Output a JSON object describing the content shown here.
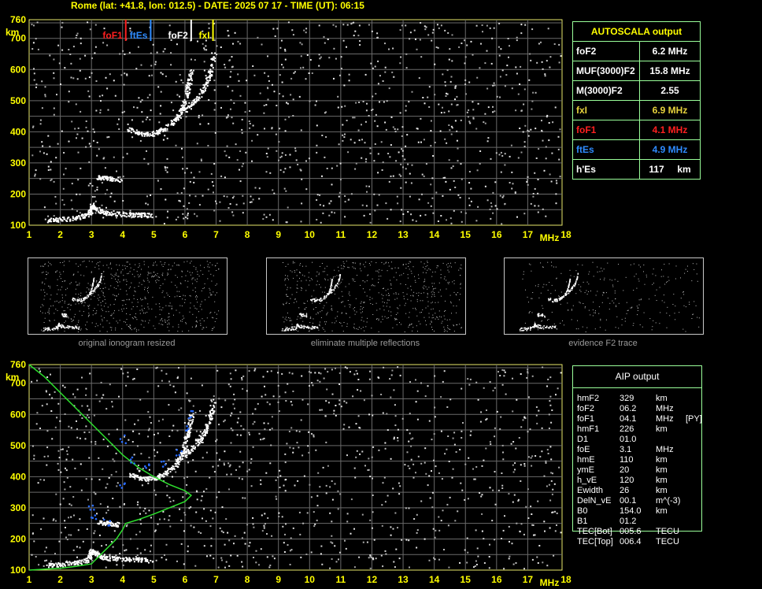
{
  "header": "Rome (lat: +41.8, lon: 012.5) - DATE: 2025 07 17 - TIME (UT): 06:15",
  "axes": {
    "x_ticks": [
      "1",
      "2",
      "3",
      "4",
      "5",
      "6",
      "7",
      "8",
      "9",
      "10",
      "11",
      "12",
      "13",
      "14",
      "15",
      "16",
      "17",
      "18"
    ],
    "x_unit": "MHz",
    "y_ticks": [
      "100",
      "200",
      "300",
      "400",
      "500",
      "600",
      "700",
      "760"
    ],
    "y_unit": "km"
  },
  "top_markers": [
    {
      "label": "foF1",
      "freq": 4.1,
      "color": "#ff2020"
    },
    {
      "label": "ftEs",
      "freq": 4.9,
      "color": "#2f8cff"
    },
    {
      "label": "foF2",
      "freq": 6.2,
      "color": "#ffffff"
    },
    {
      "label": "fxI",
      "freq": 6.9,
      "color": "#ffff00"
    }
  ],
  "autoscala": {
    "title": "AUTOSCALA output",
    "rows": [
      {
        "name": "foF2",
        "value": "6.2 MHz",
        "color": "#ffffff"
      },
      {
        "name": "MUF(3000)F2",
        "value": "15.8 MHz",
        "color": "#ffffff"
      },
      {
        "name": "M(3000)F2",
        "value": "2.55",
        "color": "#ffffff"
      },
      {
        "name": "fxI",
        "value": "6.9 MHz",
        "color": "#e6d23c"
      },
      {
        "name": "foF1",
        "value": "4.1 MHz",
        "color": "#ff2020"
      },
      {
        "name": "ftEs",
        "value": "4.9 MHz",
        "color": "#2f8cff"
      },
      {
        "name": "h'Es",
        "value": "117     km",
        "color": "#ffffff"
      }
    ]
  },
  "panels": [
    {
      "caption": "original ionogram resized"
    },
    {
      "caption": "eliminate multiple reflections"
    },
    {
      "caption": "evidence F2 trace"
    }
  ],
  "aip": {
    "title": "AIP output",
    "rows": [
      [
        "hmF2",
        "329",
        "km",
        ""
      ],
      [
        "foF2",
        "06.2",
        "MHz",
        ""
      ],
      [
        "foF1",
        "04.1",
        "MHz",
        "[PY]"
      ],
      [
        "hmF1",
        "226",
        "km",
        ""
      ],
      [
        "D1",
        "01.0",
        "",
        ""
      ],
      [
        "foE",
        "3.1",
        "MHz",
        ""
      ],
      [
        "hmE",
        "110",
        "km",
        ""
      ],
      [
        "ymE",
        "20",
        "km",
        ""
      ],
      [
        "h_vE",
        "120",
        "km",
        ""
      ],
      [
        "Ewidth",
        "26",
        "km",
        ""
      ],
      [
        "DelN_vE",
        "00.1",
        "m^(-3)",
        ""
      ],
      [
        "B0",
        "154.0",
        "km",
        ""
      ],
      [
        "B1",
        "01.2",
        "",
        ""
      ],
      [
        "TEC[Bot]",
        "005.6",
        "TECU",
        ""
      ],
      [
        "TEC[Top]",
        "006.4",
        "TECU",
        ""
      ]
    ]
  },
  "chart_data": [
    {
      "type": "scatter",
      "title": "Rome (lat: +41.8, lon: 012.5) - DATE: 2025 07 17 - TIME (UT): 06:15",
      "xlabel": "MHz",
      "ylabel": "km",
      "xlim": [
        1,
        18
      ],
      "ylim": [
        100,
        760
      ],
      "series": [
        {
          "name": "Es trace",
          "points": [
            [
              1.6,
              117
            ],
            [
              2.0,
              120
            ],
            [
              2.5,
              125
            ],
            [
              2.9,
              135
            ],
            [
              3.0,
              165
            ],
            [
              3.2,
              150
            ],
            [
              3.5,
              140
            ],
            [
              4.0,
              137
            ],
            [
              4.5,
              135
            ],
            [
              4.9,
              133
            ]
          ]
        },
        {
          "name": "F1 trace",
          "points": [
            [
              3.2,
              255
            ],
            [
              3.5,
              252
            ],
            [
              3.9,
              248
            ]
          ]
        },
        {
          "name": "F2 trace",
          "points": [
            [
              4.2,
              410
            ],
            [
              4.6,
              395
            ],
            [
              5.0,
              395
            ],
            [
              5.3,
              410
            ],
            [
              5.7,
              440
            ],
            [
              5.9,
              470
            ],
            [
              6.0,
              510
            ],
            [
              6.1,
              550
            ],
            [
              6.2,
              600
            ]
          ]
        },
        {
          "name": "X trace",
          "points": [
            [
              6.0,
              470
            ],
            [
              6.3,
              500
            ],
            [
              6.6,
              540
            ],
            [
              6.8,
              590
            ],
            [
              6.9,
              650
            ]
          ]
        }
      ]
    },
    {
      "type": "line",
      "xlabel": "MHz",
      "ylabel": "km",
      "xlim": [
        1,
        18
      ],
      "ylim": [
        100,
        760
      ],
      "series": [
        {
          "name": "electron density profile",
          "points": [
            [
              1.0,
              760
            ],
            [
              1.5,
              720
            ],
            [
              2.0,
              670
            ],
            [
              2.5,
              620
            ],
            [
              3.0,
              570
            ],
            [
              3.5,
              520
            ],
            [
              4.0,
              470
            ],
            [
              4.5,
              430
            ],
            [
              5.0,
              400
            ],
            [
              5.5,
              375
            ],
            [
              6.0,
              355
            ],
            [
              6.2,
              340
            ],
            [
              6.0,
              320
            ],
            [
              5.5,
              300
            ],
            [
              5.0,
              280
            ],
            [
              4.5,
              262
            ],
            [
              4.1,
              250
            ],
            [
              4.0,
              230
            ],
            [
              3.8,
              200
            ],
            [
              3.5,
              170
            ],
            [
              3.1,
              130
            ],
            [
              3.0,
              120
            ],
            [
              2.5,
              112
            ],
            [
              2.0,
              106
            ],
            [
              1.0,
              100
            ]
          ]
        },
        {
          "name": "scaled trace",
          "points": [
            [
              3.0,
              300
            ],
            [
              3.1,
              265
            ],
            [
              3.5,
              255
            ],
            [
              4.0,
              370
            ],
            [
              4.0,
              520
            ],
            [
              4.3,
              450
            ],
            [
              4.8,
              430
            ],
            [
              5.3,
              440
            ],
            [
              5.8,
              480
            ],
            [
              6.1,
              560
            ],
            [
              6.2,
              600
            ]
          ]
        }
      ]
    }
  ]
}
